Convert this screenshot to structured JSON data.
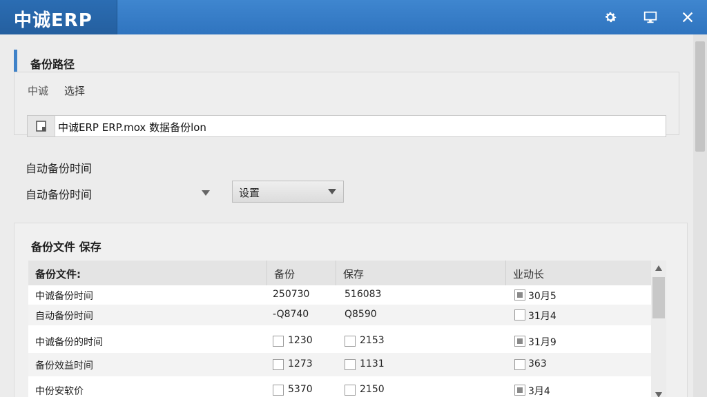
{
  "titlebar": {
    "app_title": "中诚ERP",
    "icons": [
      "gear-icon",
      "monitor-icon",
      "close-icon"
    ]
  },
  "backup_path": {
    "section_title": "备份路径",
    "label": "中诚",
    "select_label": "选择",
    "path_value": "中诚ERP ERP.mox  数据备份lon"
  },
  "auto_backup": {
    "title": "自动备份时间",
    "label": "自动备份时间",
    "select_value": "设置"
  },
  "backup_files": {
    "section_title": "备份文件 保存",
    "columns": [
      "备份文件:",
      "备份",
      "保存",
      "业动长"
    ],
    "rows": [
      {
        "name": "中诚备份时间",
        "c1": "250730",
        "c1_check": null,
        "c2": "516083",
        "c2_check": null,
        "c3": "30月5",
        "c3_checked": true
      },
      {
        "name": "自动备份时间",
        "c1": "-Q8740",
        "c1_check": null,
        "c2": "Q8590",
        "c2_check": null,
        "c3": "31月4",
        "c3_checked": false
      },
      {
        "name": "中诚备份的时间",
        "c1": "1230",
        "c1_check": false,
        "c2": "2153",
        "c2_check": false,
        "c3": "31月9",
        "c3_checked": true
      },
      {
        "name": "备份效益时间",
        "c1": "1273",
        "c1_check": false,
        "c2": "1131",
        "c2_check": false,
        "c3": "363",
        "c3_checked": false
      },
      {
        "name": "中份安软价",
        "c1": "5370",
        "c1_check": false,
        "c2": "2150",
        "c2_check": false,
        "c3": "3月4",
        "c3_checked": true
      }
    ]
  },
  "colors": {
    "titlebar": "#3a80c9",
    "accent": "#3f82c8",
    "background": "#ececec"
  }
}
